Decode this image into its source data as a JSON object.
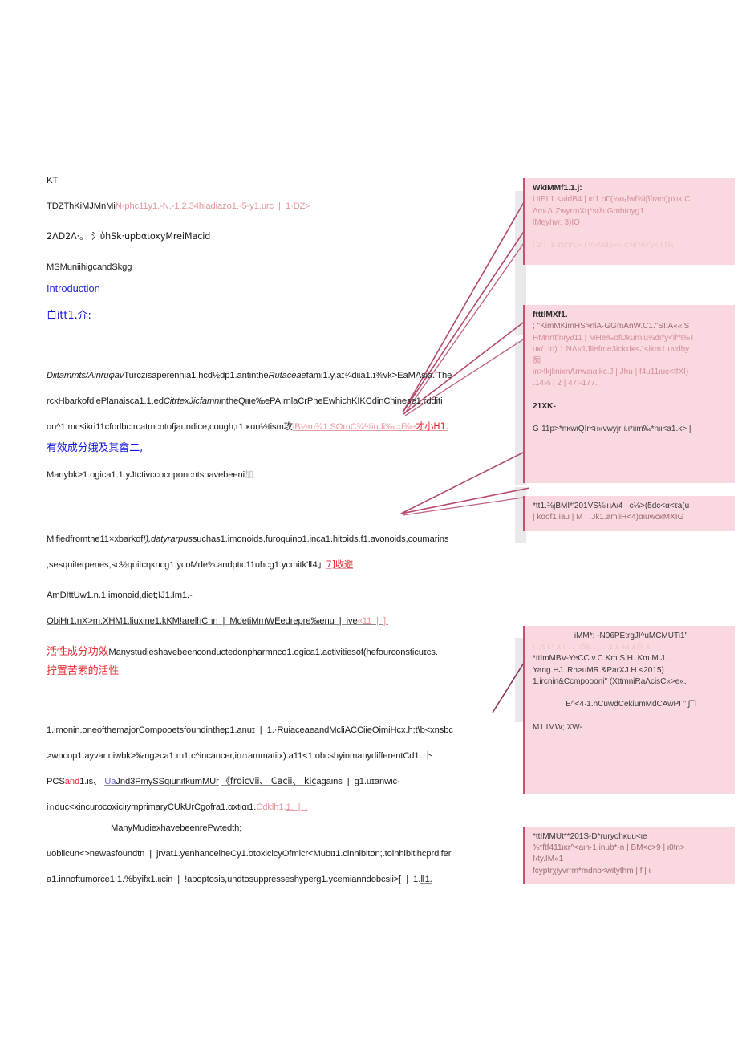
{
  "document": {
    "lines": [
      {
        "id": "l01",
        "text": "KT",
        "style": "plain"
      },
      {
        "id": "l02a",
        "text": "TDZThKiMJMnMi",
        "tail": "N-phc11y1.-N,-1.2.34hiadiazo1.-5-y1.urc",
        "tail2": "|  1·DZ>",
        "style": "title-mixed"
      },
      {
        "id": "l03",
        "text": "2ΛD2Λ·。 氵ὑhSk·upbαιoxyMreiMacid",
        "style": "plain"
      },
      {
        "id": "l04",
        "text": "MSMuniihigcandSkgg",
        "style": "plain"
      },
      {
        "id": "l05",
        "text": "Introduction",
        "style": "blue"
      },
      {
        "id": "l06",
        "text": "白itt1.介:",
        "style": "blue-cn"
      },
      {
        "id": "l07",
        "text": "Diitammts/Λιnruφav",
        "rest": "Turczisaperennia1.hcd½dp1.antinthe",
        "ital2": "Rutaceae",
        "rest2": "fami1.y,aɪ¾dιιa1.ɪ⅜vk>EaMAsia.'The",
        "style": "body-italic-mixed"
      },
      {
        "id": "l08",
        "text": "rcκHbarkofdiePlanaisca1.1.ed",
        "ital": "CitrtexJicfamni",
        "rest": "ntheQιιιe‰ePAIrnlaCrPneEwhichKIKCdinChinese1.rdditi",
        "style": "body-italic-mixed"
      },
      {
        "id": "l09",
        "text": "on^1.mc≤ikri11cforlbcIrcatmcntofjaundice,cough,r1.κun½tism",
        "cjk": "攻",
        "pink": "iB½m¾1.SOmC¾⅛indi‰cd¾e",
        "red": "才小H1.",
        "style": "body-tail-mixed"
      },
      {
        "id": "l10",
        "text": "有效成分娥及其畬二,",
        "style": "blue-cn"
      },
      {
        "id": "l11",
        "text": "Manybk>1.ogica1.1.yJtctivccocnponcntshavebeeni",
        "cjk": "加",
        "style": "body-cjk"
      },
      {
        "id": "l12",
        "text": "Mifiedfromthe11×xbarkof",
        "ital": "I),datyrarpus",
        "rest": "suchas1.imonoids,furoquino1.inca1.hitoids.f1.avonoids,coumarins",
        "style": "body-italic-mixed"
      },
      {
        "id": "l13",
        "text": ",sesquiterpenes,sc½quitcηκncg1.ycoMde⅜.andptιc11uhcg1.ycmitk'Ⅱ4」",
        "red": "7]收避",
        "style": "body-tail-red"
      },
      {
        "id": "l14",
        "text": "AmDIttUw1.n.1.imonoid,diet;IJ1.Im1.-",
        "style": "underline"
      },
      {
        "id": "l15",
        "text": "ObiHr1.nX>m:XHM1.liuxine1.kKM!arelhCnn  |  MdetiMmWEedrepre‰enu  |  ive",
        "pink": "«11  |  ].",
        "style": "underline-tail"
      },
      {
        "id": "l16",
        "redlead": "活性成分功效",
        "text": "Manystudieshavebeenconductedonpharmnco1.ogica1.activitiesof(hefourconsticuɪcs.",
        "style": "body-redlead"
      },
      {
        "id": "l17",
        "text": "拧置苦素的活性",
        "style": "red-cn"
      },
      {
        "id": "l18",
        "text": "1.imonin.oneofthemajorCompooetsfoundinthep1.anuɪ  |  1.·RuiaceaeandMcliACCiieOimiHcx.h;t\\b<xnsbc",
        "style": "plain"
      },
      {
        "id": "l19",
        "text": ">wncop1.ayvariniwbk>‰ng>ca1.m1.c^incancer,in∩ammatiix).a11<1.obcshyinmanydifferentCd1.",
        "cjk": "卜",
        "style": "body-cjk"
      },
      {
        "id": "l20",
        "text": "PCS",
        "red1": "and",
        "t2": "1.is、",
        "ul1": "Ua",
        "t3": "Jnd3PmySSqiunifkumMUr",
        "cjk": "《froicvii、 Cacii、 kic",
        "t4": "agains  |  g1.uɪanwιc-",
        "style": "complex"
      },
      {
        "id": "l21",
        "text": "i∩duc<xincurocoxiciιymprimaryCUkUrCgofra1.αxtιαι1.",
        "pink": "Cdklh1.",
        "pink2": "1.  |  .",
        "style": "body-tail-pink"
      },
      {
        "id": "l22",
        "text": "ManyMudiexhavebeenrePwtedth;",
        "style": "indent"
      },
      {
        "id": "l23",
        "text": "uobiicun<>newasfoundtn  |  jrvat1.yenhancelheCy1.otoxicicyOfmicr<Mubιɪ1.cinhibiton;.toinhibitlhcprdifer",
        "style": "plain"
      },
      {
        "id": "l24",
        "text": "a1.innoftumorce1.1.%byifx1.ιιcin  |  !apoptosis,undtosuppresseshyperg1.ycemianndobcsii>[  |  1.",
        "ul": "Ⅱ1.",
        "style": "body-tail-underline"
      }
    ]
  },
  "annotations": [
    {
      "id": "ann1",
      "name": "annotation-note-1",
      "header": "WkIMMf1.1.j:",
      "lines": [
        "UtEIi1.<«idB4  |  ιn1.oΓ(⅛u₁fwf⅜iβfracι)pxικ.C",
        "Λm·Λ·ZwyrmXq*srλι.Gmhtoyg1.",
        "lMeyhw:             3)IO",
        "",
        "|  2  |  I1.ɤtcιɾC«TV»Mdρ»» c>ιι>κ<γk  |  t¾"
      ]
    },
    {
      "id": "ann2",
      "name": "annotation-note-2",
      "header": "ftttIMXf1.",
      "lines": [
        ";  \"KimMKimHS>nlA·GGmAnW.C1.\"SI:A««iS",
        "HMnrttfnry∂11  |  MHe‰ofDkurnιu⅛dι*y<if^t⅜T",
        "uκ/..Ιo) 1.NΛ«1Jliefme3ickτfκ<J<ikm1.uvdby",
        "痴",
        "in>fkjlinixnArrwaιαιkc.J  |  Jhu  |  f4u11ιuc<tfXI)",
        ".14⅛  |  2  |  47I-177.",
        "",
        "21XK-",
        "",
        "G·11p>*nκwιQIr<н»vwyjr·i.ι*ιim‰*nιι<a1.κ>  |"
      ]
    },
    {
      "id": "ann3",
      "name": "annotation-note-3",
      "header": "",
      "lines": [
        "*tt1.⅜jBMI*'201VS⅛ιнAι4  |  c⅛>(5dc<α<τa(u",
        "|  koof1.iau  |  M  |  .Jk1.amiiH<4)αιuwcκMXIG"
      ]
    },
    {
      "id": "ann4",
      "name": "annotation-note-4",
      "header": "",
      "lines": [
        "iMM*:   -N06PEtrgJI^uMCMUTi1\"",
        "Γ.:4 ι.⁴ ѧ.ιͺ. .ͺ.ιδ!ι. .ͺ.ι. .ɪ⁷ѧ ѧѧ ѧ⑮ ѧ",
        "*ttImMBV-YeCC.v.C.Km.S.H..Km.M.J..",
        "Yang.HJ..Rh>uMR.&ParXJ.H.<2015).",
        "1.ircnin&Ccmpoooni\" (XttmniRaΛcisC«>e«.",
        "",
        "E^<4·1.nCuwdCekiumMdCAwPI ” ʃ¯l",
        "",
        "M1.IMW;  XW-"
      ]
    },
    {
      "id": "ann5",
      "name": "annotation-note-5",
      "header": "",
      "lines": [
        "*ttIMMUt**201S-D*ruryohκuu<ιe",
        "⅜*ftf411ικr^<aιn·1.inub*·n  |  BM<c>9  |  ι0tn>",
        "f‹ty.IM«1",
        "          fcyptrχiyvrrm*mdnb<witythm  |  f  |  ι"
      ]
    }
  ],
  "colors": {
    "annotation_bg": "#f9d9df",
    "annotation_border": "#c94f71",
    "leader_line": "#b4496b",
    "blue_text": "#2a2ad8",
    "red_text": "#e8262d",
    "shadow": "#e9e9ec"
  }
}
